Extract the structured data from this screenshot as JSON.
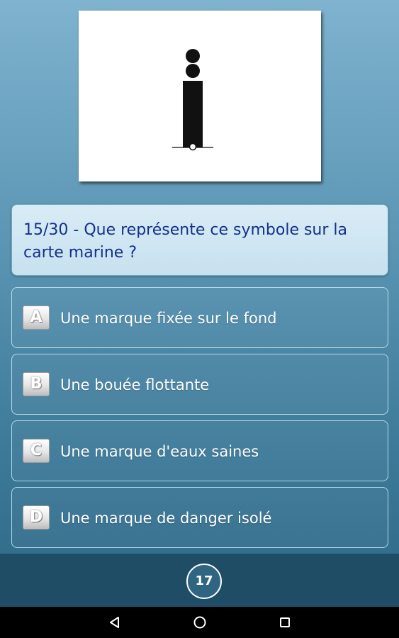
{
  "symbol": {
    "icon": "isolated-danger-mark-symbol",
    "colors": {
      "mark": "#111111",
      "background": "#ffffff"
    }
  },
  "question": {
    "text": "15/30 - Que représente ce symbole sur la carte marine ?"
  },
  "answers": [
    {
      "letter": "A",
      "text": "Une marque fixée sur le fond"
    },
    {
      "letter": "B",
      "text": "Une bouée flottante"
    },
    {
      "letter": "C",
      "text": "Une marque d'eaux saines"
    },
    {
      "letter": "D",
      "text": "Une marque de danger isolé"
    }
  ],
  "counter": {
    "value": "17"
  },
  "nav": {
    "icons": [
      "back-triangle-icon",
      "home-circle-icon",
      "recents-square-icon"
    ]
  },
  "colors": {
    "question_text": "#14308a",
    "bottom_bar": "#1f4d66",
    "nav_bar": "#000000"
  }
}
